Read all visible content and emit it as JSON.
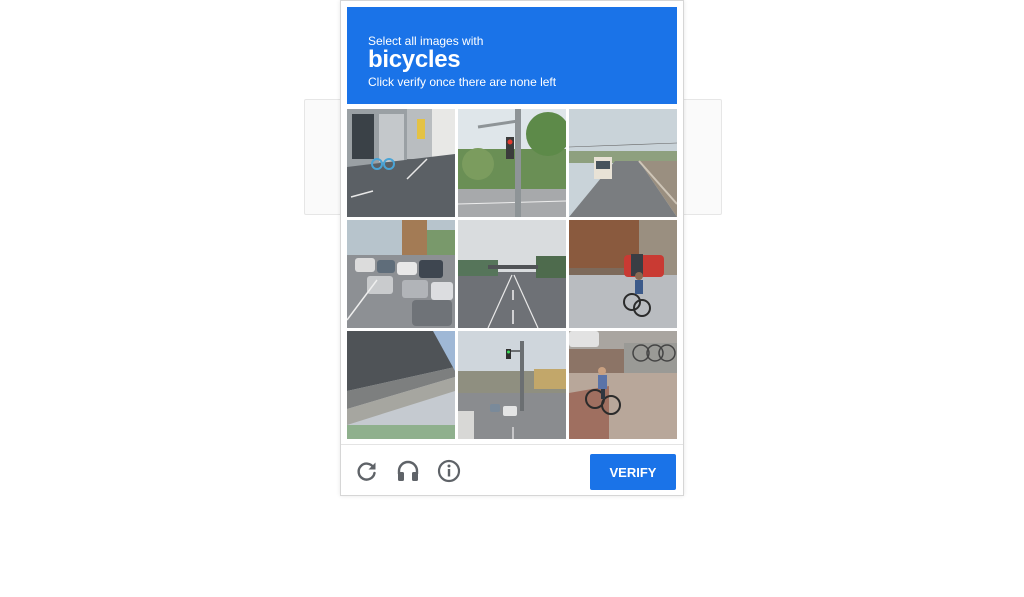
{
  "challenge": {
    "instruction": "Select all images with",
    "keyword": "bicycles",
    "subtext": "Click verify once there are none left"
  },
  "tiles": [
    {
      "label": "storefront with parked bicycle"
    },
    {
      "label": "traffic light and street"
    },
    {
      "label": "bus on road"
    },
    {
      "label": "traffic jam with cars"
    },
    {
      "label": "highway with overpass"
    },
    {
      "label": "cyclist on sidewalk"
    },
    {
      "label": "underside of bridge"
    },
    {
      "label": "street intersection with traffic light"
    },
    {
      "label": "cyclist riding near parked bikes"
    }
  ],
  "footer": {
    "reload_icon": "reload-icon",
    "audio_icon": "headphones-icon",
    "info_icon": "info-icon",
    "verify_label": "VERIFY"
  },
  "colors": {
    "accent": "#1a73e8",
    "icon_gray": "#5f6368"
  }
}
